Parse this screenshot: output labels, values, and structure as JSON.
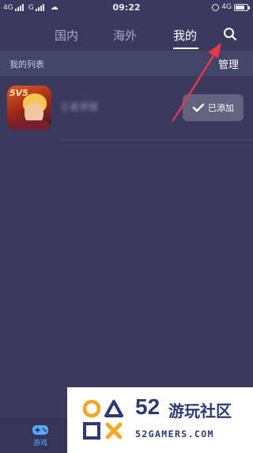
{
  "status_bar": {
    "left_network_1": "4G",
    "left_network_2": "G",
    "time": "09:22",
    "right_network": "4G"
  },
  "tabs": [
    {
      "label": "国内",
      "active": false
    },
    {
      "label": "海外",
      "active": false
    },
    {
      "label": "我的",
      "active": true
    }
  ],
  "search": {
    "icon": "search-icon"
  },
  "list_header": {
    "title": "我的列表",
    "manage_label": "管理"
  },
  "game": {
    "name": "王者荣耀",
    "icon_badge": "5V5",
    "button_label": "已添加",
    "button_icon": "checkmark-icon"
  },
  "bottom_nav": {
    "games_label": "游戏"
  },
  "watermark": {
    "number": "52",
    "name": "游玩社区",
    "site": "52GAMERS.COM"
  },
  "colors": {
    "background": "#393a5e",
    "header_bar": "#424469",
    "button_bg": "#61637f",
    "active_nav": "#5aa9ff",
    "annotation_arrow": "#e8394a",
    "logo_orange": "#f5a623",
    "logo_blue": "#2c3a74"
  }
}
